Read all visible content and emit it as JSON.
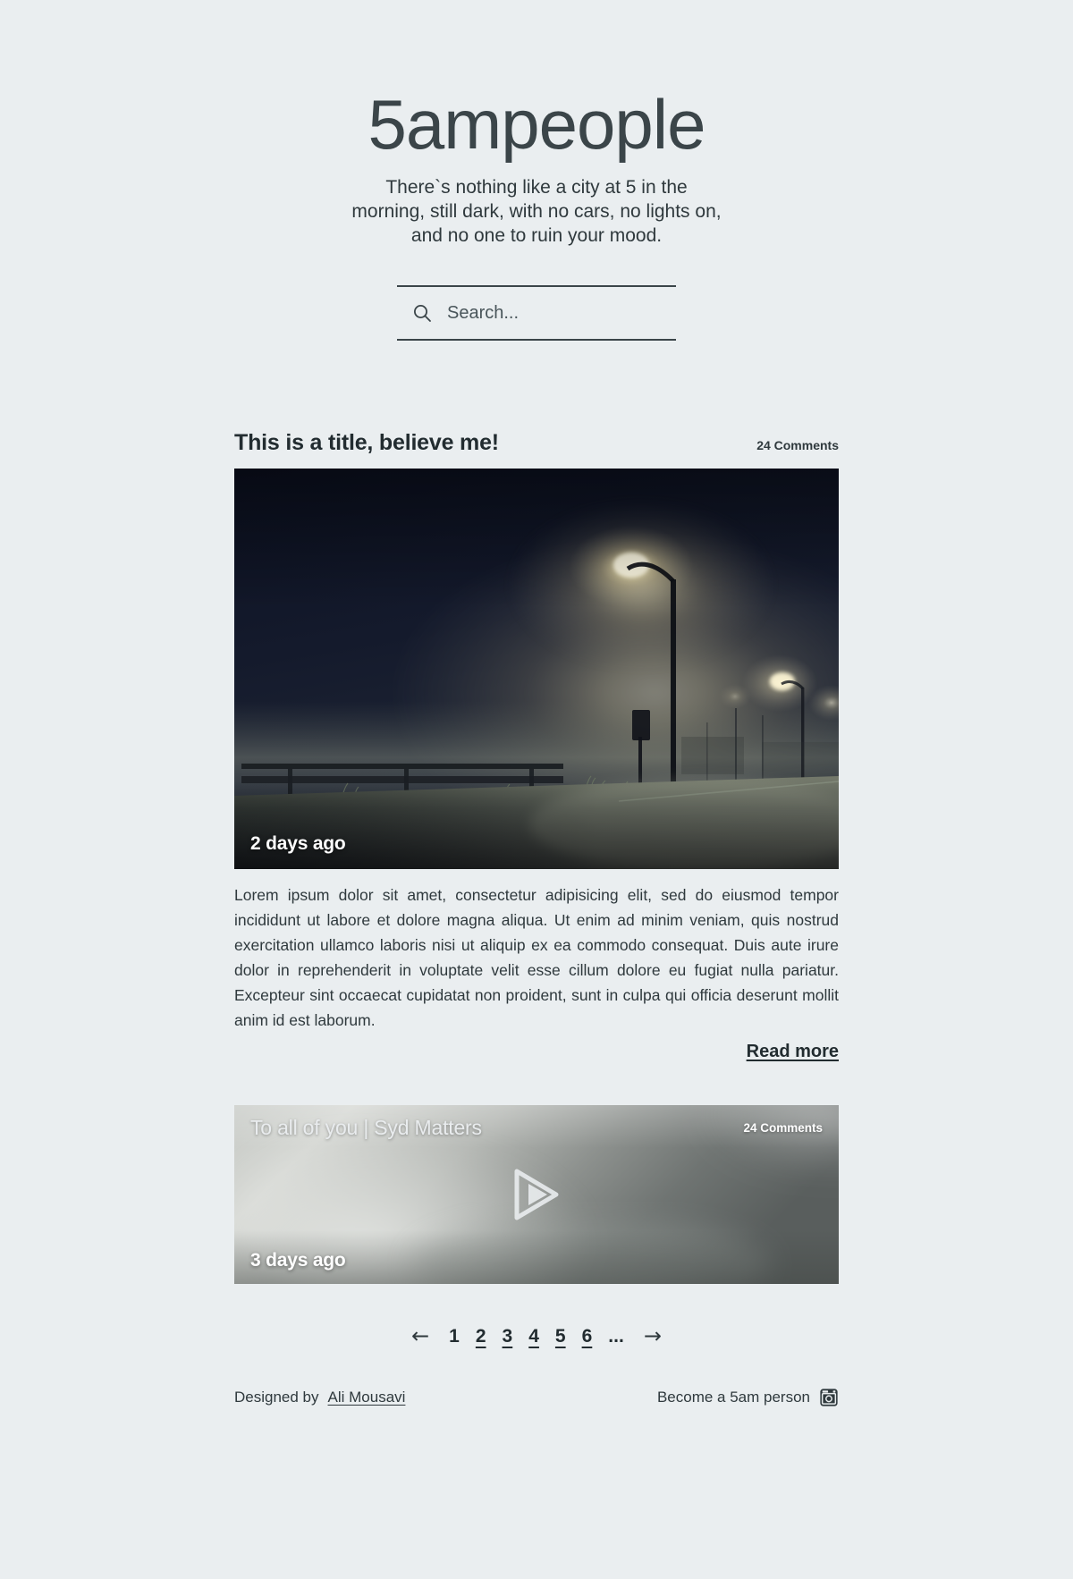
{
  "site": {
    "title": "5ampeople",
    "tagline": "There`s nothing like a city at 5 in the morning, still dark, with no cars, no lights on, and no one to ruin your mood."
  },
  "search": {
    "placeholder": "Search...",
    "value": "",
    "icon": "search-icon"
  },
  "posts": [
    {
      "type": "photo",
      "title": "This is a title, believe me!",
      "comments": "24 Comments",
      "date": "2 days ago",
      "body": "Lorem ipsum dolor sit amet, consectetur adipisicing elit, sed do eiusmod tempor incididunt ut labore et dolore magna aliqua. Ut enim ad minim veniam, quis nostrud exercitation ullamco laboris nisi ut aliquip ex ea commodo consequat. Duis aute irure dolor in reprehenderit in voluptate velit esse cillum dolore eu fugiat nulla pariatur. Excepteur sint occaecat cupidatat non proident, sunt in culpa qui officia deserunt mollit anim id est laborum.",
      "read_more": "Read more"
    },
    {
      "type": "video",
      "title": "To all of you | Syd Matters",
      "comments": "24 Comments",
      "date": "3 days ago",
      "play_icon": "play-icon"
    }
  ],
  "pagination": {
    "prev": "←",
    "next": "→",
    "pages": [
      "1",
      "2",
      "3",
      "4",
      "5",
      "6"
    ],
    "current": "1",
    "ellipsis": "..."
  },
  "footer": {
    "designed_by_prefix": "Designed by ",
    "designer": "Ali Mousavi",
    "social_label": "Become a 5am person",
    "social_icon": "instagram-icon"
  },
  "colors": {
    "background": "#eaeef0",
    "text": "#2f393d",
    "heading": "#222c30",
    "rule": "#3b4549"
  }
}
